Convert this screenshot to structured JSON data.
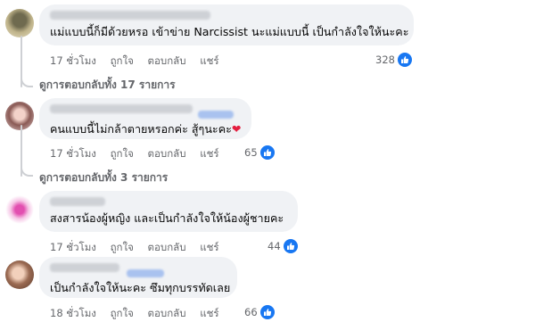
{
  "comments": [
    {
      "text": "แม่แบบนี้ก็มีด้วยหรอ เข้าข่าย Narcissist นะแม่แบบนี้ เป็นกำลังใจให้นะคะ",
      "time": "17 ชั่วโมง",
      "like": "ถูกใจ",
      "reply": "ตอบกลับ",
      "share": "แชร์",
      "reaction_count": "328",
      "view_replies": "ดูการตอบกลับทั้ง 17 รายการ"
    },
    {
      "text": "คนแบบนี้ไม่กล้าตายหรอกค่ะ สู้ๆนะคะ",
      "emoji": "❤",
      "time": "17 ชั่วโมง",
      "like": "ถูกใจ",
      "reply": "ตอบกลับ",
      "share": "แชร์",
      "reaction_count": "65",
      "view_replies": "ดูการตอบกลับทั้ง 3 รายการ"
    },
    {
      "text": "สงสารน้องผู้หญิง และเป็นกำลังใจให้น้องผู้ชายคะ",
      "time": "17 ชั่วโมง",
      "like": "ถูกใจ",
      "reply": "ตอบกลับ",
      "share": "แชร์",
      "reaction_count": "44"
    },
    {
      "text": "เป็นกำลังใจให้นะคะ ซึมทุกบรรทัดเลย",
      "time": "18 ชั่วโมง",
      "like": "ถูกใจ",
      "reply": "ตอบกลับ",
      "share": "แชร์",
      "reaction_count": "66"
    }
  ],
  "colors": {
    "bubble": "#f0f2f5",
    "meta_text": "#65676b",
    "like_blue": "#1877f2",
    "heart": "#e41e3f"
  }
}
